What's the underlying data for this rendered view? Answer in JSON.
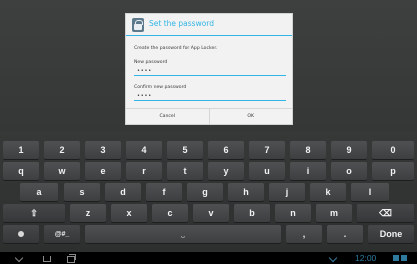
{
  "dialog": {
    "title": "Set the password",
    "message": "Create the password for App Locker.",
    "new_password_label": "New password",
    "new_password_value": "••••",
    "confirm_password_label": "Confirm new password",
    "confirm_password_value": "••••",
    "cancel_label": "Cancel",
    "ok_label": "OK"
  },
  "keyboard": {
    "row1": [
      "1",
      "2",
      "3",
      "4",
      "5",
      "6",
      "7",
      "8",
      "9",
      "0"
    ],
    "row2": [
      "q",
      "w",
      "e",
      "r",
      "t",
      "y",
      "u",
      "i",
      "o",
      "p"
    ],
    "row3": [
      "a",
      "s",
      "d",
      "f",
      "g",
      "h",
      "j",
      "k",
      "l"
    ],
    "row4": [
      "z",
      "x",
      "c",
      "v",
      "b",
      "n",
      "m"
    ],
    "shift_glyph": "⇧",
    "delete_glyph": "⌫",
    "symbols_label": "@#_",
    "space_glyph": "⎵",
    "comma": ",",
    "period": ".",
    "done_label": "Done"
  },
  "navbar": {
    "time": "12:00"
  },
  "colors": {
    "accent": "#33b5e5",
    "key": "#474a4c",
    "keyboard_bg": "#303232"
  }
}
